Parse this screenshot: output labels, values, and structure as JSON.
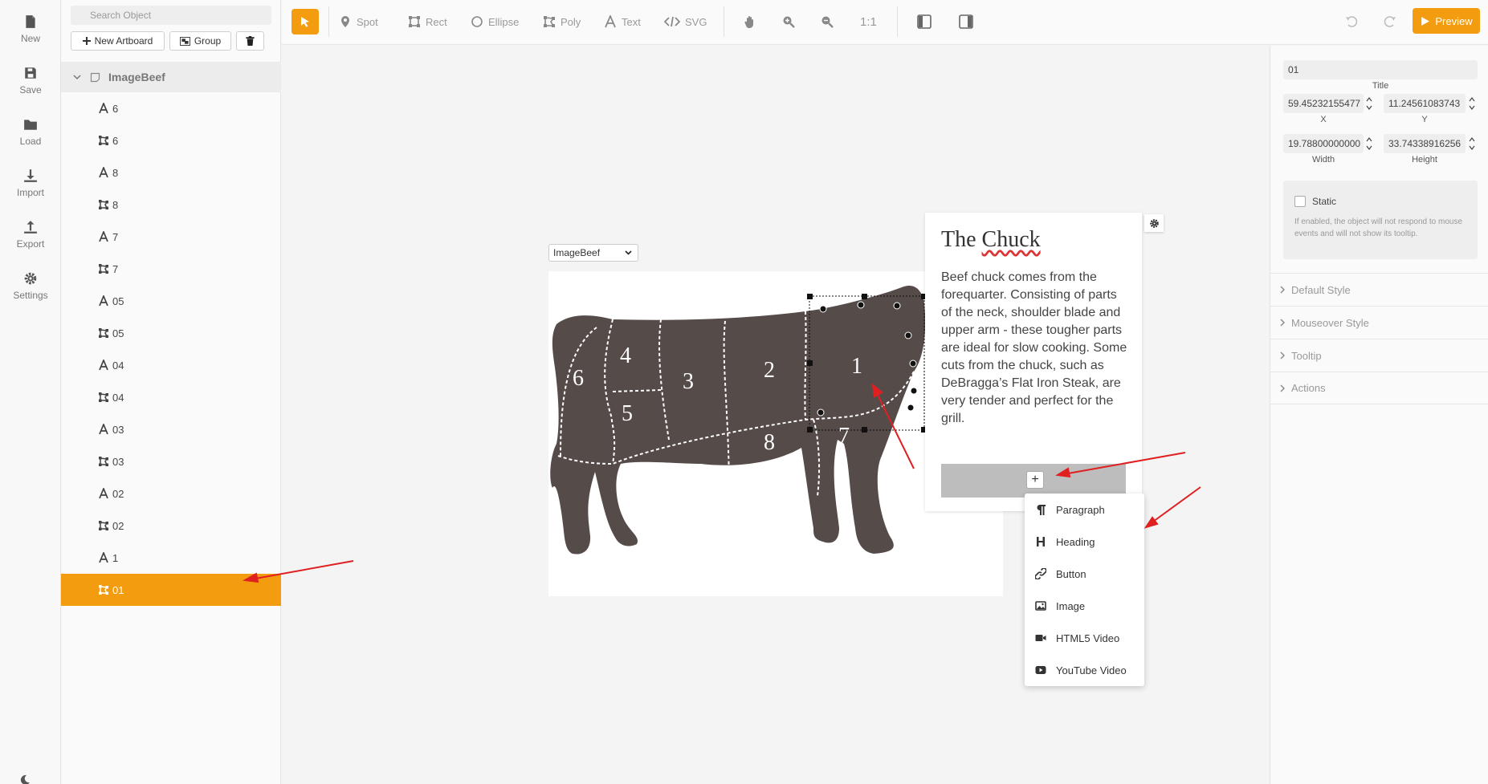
{
  "rail": {
    "items": [
      {
        "label": "New",
        "icon": "file-icon"
      },
      {
        "label": "Save",
        "icon": "save-icon"
      },
      {
        "label": "Load",
        "icon": "folder-icon"
      },
      {
        "label": "Import",
        "icon": "import-icon"
      },
      {
        "label": "Export",
        "icon": "export-icon"
      },
      {
        "label": "Settings",
        "icon": "gear-icon"
      }
    ]
  },
  "objects": {
    "search_placeholder": "Search Object",
    "new_artboard_label": "New Artboard",
    "group_label": "Group",
    "root_name": "ImageBeef",
    "items": [
      {
        "label": "6",
        "type": "text",
        "icon": "text-icon"
      },
      {
        "label": "6",
        "type": "poly",
        "icon": "polygon-icon"
      },
      {
        "label": "8",
        "type": "text",
        "icon": "text-icon"
      },
      {
        "label": "8",
        "type": "poly",
        "icon": "polygon-icon"
      },
      {
        "label": "7",
        "type": "text",
        "icon": "text-icon"
      },
      {
        "label": "7",
        "type": "poly",
        "icon": "polygon-icon"
      },
      {
        "label": "05",
        "type": "text",
        "icon": "text-icon"
      },
      {
        "label": "05",
        "type": "poly",
        "icon": "polygon-icon"
      },
      {
        "label": "04",
        "type": "text",
        "icon": "text-icon"
      },
      {
        "label": "04",
        "type": "poly",
        "icon": "polygon-icon"
      },
      {
        "label": "03",
        "type": "text",
        "icon": "text-icon"
      },
      {
        "label": "03",
        "type": "poly",
        "icon": "polygon-icon"
      },
      {
        "label": "02",
        "type": "text",
        "icon": "text-icon"
      },
      {
        "label": "02",
        "type": "poly",
        "icon": "polygon-icon"
      },
      {
        "label": "1",
        "type": "text",
        "icon": "text-icon"
      },
      {
        "label": "01",
        "type": "poly",
        "icon": "polygon-icon",
        "selected": true
      }
    ]
  },
  "toolbar": {
    "tools": [
      {
        "label": "Spot",
        "icon": "pin-icon"
      },
      {
        "label": "Rect",
        "icon": "rect-icon"
      },
      {
        "label": "Ellipse",
        "icon": "ellipse-icon"
      },
      {
        "label": "Poly",
        "icon": "polygon-icon"
      },
      {
        "label": "Text",
        "icon": "text-icon"
      },
      {
        "label": "SVG",
        "icon": "code-icon"
      }
    ],
    "zoom_label": "1:1",
    "preview_label": "Preview",
    "accent": "#f39c0f"
  },
  "canvas": {
    "artboard_select": "ImageBeef",
    "cow_color": "#554b49",
    "cut_labels": [
      "6",
      "4",
      "5",
      "3",
      "2",
      "1",
      "8",
      "7"
    ]
  },
  "popup": {
    "title_prefix": "The ",
    "title_word": "Chuck",
    "body": "Beef chuck comes from the forequarter. Consisting of parts of the neck, shoulder blade and upper arm - these tougher parts are ideal for slow cooking. Some cuts from the chuck, such as DeBragga’s Flat Iron Steak, are very tender and perfect for the grill.",
    "add_symbol": "+"
  },
  "menu": {
    "items": [
      {
        "label": "Paragraph",
        "icon": "paragraph-icon"
      },
      {
        "label": "Heading",
        "icon": "heading-icon"
      },
      {
        "label": "Button",
        "icon": "link-icon"
      },
      {
        "label": "Image",
        "icon": "image-icon"
      },
      {
        "label": "HTML5 Video",
        "icon": "video-icon"
      },
      {
        "label": "YouTube Video",
        "icon": "youtube-icon"
      }
    ]
  },
  "props": {
    "title_value": "01",
    "title_label": "Title",
    "x_value": "59.45232155477",
    "x_label": "X",
    "y_value": "11.24561083743",
    "y_label": "Y",
    "width_value": "19.78800000000",
    "width_label": "Width",
    "height_value": "33.74338916256",
    "height_label": "Height",
    "static_label": "Static",
    "static_help": "If enabled, the object will not respond to mouse events and will not show its tooltip.",
    "sections": [
      "Default Style",
      "Mouseover Style",
      "Tooltip",
      "Actions"
    ]
  }
}
